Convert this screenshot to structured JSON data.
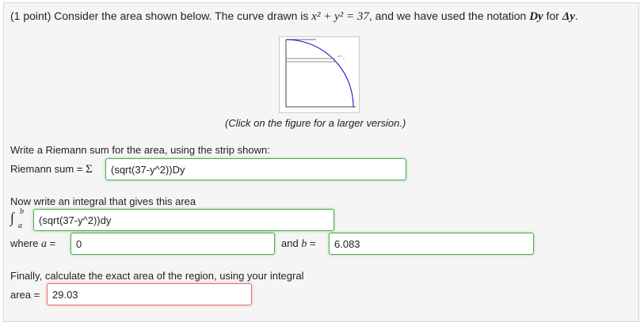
{
  "problem": {
    "points": "(1 point)",
    "intro": "Consider the area shown below. The curve drawn is",
    "equation": "x² + y² = 37",
    "notation_text": ", and we have used the notation",
    "notation_symbol": "Dy",
    "for_text": "for",
    "delta_symbol": "Δy",
    "end": "."
  },
  "figure": {
    "caption": "(Click on the figure for a larger version.)"
  },
  "riemann": {
    "prompt": "Write a Riemann sum for the area, using the strip shown:",
    "label": "Riemann sum =",
    "sigma": "Σ",
    "answer": "(sqrt(37-y^2))Dy",
    "status": "correct"
  },
  "integral": {
    "prompt": "Now write an integral that gives this area",
    "symbol": "∫",
    "upper": "b",
    "lower": "a",
    "answer": "(sqrt(37-y^2))dy",
    "status": "correct"
  },
  "bounds": {
    "where_label": "where",
    "a_symbol": "a",
    "a_value": "0",
    "and_label": "and",
    "b_symbol": "b",
    "b_value": "6.083",
    "equals": "="
  },
  "area": {
    "prompt": "Finally, calculate the exact area of the region, using your integral",
    "label": "area =",
    "value": "29.03",
    "status": "incorrect"
  },
  "colors": {
    "correct_border": "#4caf50",
    "incorrect_border": "#e57373",
    "curve": "#0000cc"
  }
}
